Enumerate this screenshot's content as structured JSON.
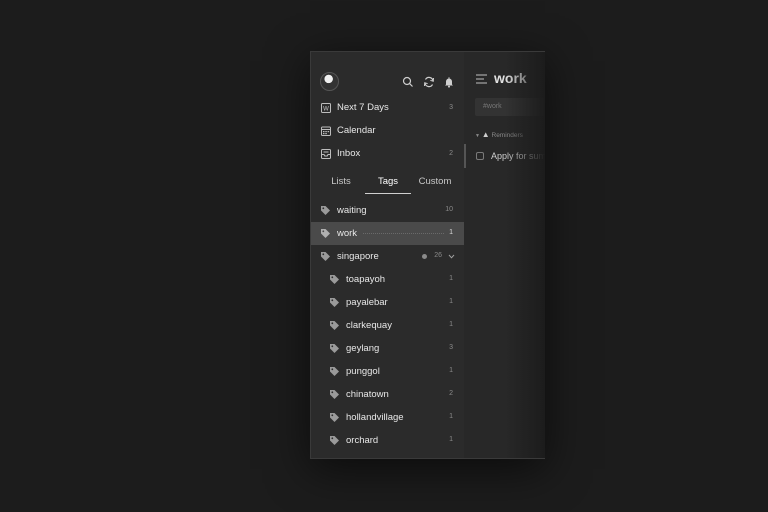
{
  "nav": [
    {
      "label": "Next 7 Days",
      "count": "3",
      "icon": "calendar-week-icon"
    },
    {
      "label": "Calendar",
      "count": "",
      "icon": "calendar-icon"
    },
    {
      "label": "Inbox",
      "count": "2",
      "icon": "inbox-icon"
    }
  ],
  "tabs": {
    "lists": "Lists",
    "tags": "Tags",
    "custom": "Custom"
  },
  "tags": [
    {
      "label": "waiting",
      "count": "10"
    },
    {
      "label": "work",
      "count": "1"
    },
    {
      "label": "singapore",
      "count": "26"
    }
  ],
  "subtags": [
    {
      "label": "toapayoh",
      "count": "1"
    },
    {
      "label": "payalebar",
      "count": "1"
    },
    {
      "label": "clarkequay",
      "count": "1"
    },
    {
      "label": "geylang",
      "count": "3"
    },
    {
      "label": "punggol",
      "count": "1"
    },
    {
      "label": "chinatown",
      "count": "2"
    },
    {
      "label": "hollandvillage",
      "count": "1"
    },
    {
      "label": "orchard",
      "count": "1"
    }
  ],
  "main": {
    "title": "work",
    "search_placeholder": "#work",
    "section": "Reminders",
    "task": "Apply for sum"
  },
  "colors": {
    "background": "#1c1c1c",
    "sidebar": "#2b2b2b",
    "selected": "#4a4a4a"
  }
}
